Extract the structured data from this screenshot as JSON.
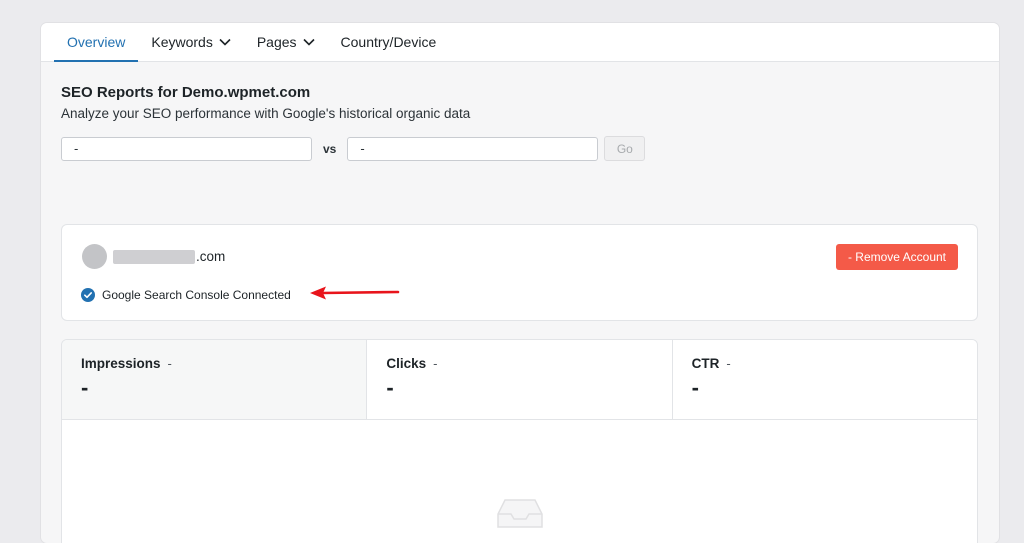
{
  "tabs": [
    {
      "label": "Overview",
      "active": true,
      "dropdown": false
    },
    {
      "label": "Keywords",
      "active": false,
      "dropdown": true
    },
    {
      "label": "Pages",
      "active": false,
      "dropdown": true
    },
    {
      "label": "Country/Device",
      "active": false,
      "dropdown": false
    }
  ],
  "header": {
    "title": "SEO Reports for Demo.wpmet.com",
    "subtitle": "Analyze your SEO performance with Google's historical organic data"
  },
  "compare": {
    "left_value": "-",
    "vs_label": "vs",
    "right_value": "-",
    "go_label": "Go"
  },
  "account": {
    "domain_suffix": ".com",
    "remove_label": "- Remove Account",
    "connected_label": "Google Search Console Connected"
  },
  "metrics": [
    {
      "label": "Impressions",
      "change": "-",
      "value": "-"
    },
    {
      "label": "Clicks",
      "change": "-",
      "value": "-"
    },
    {
      "label": "CTR",
      "change": "-",
      "value": "-"
    }
  ],
  "colors": {
    "accent": "#2271b1",
    "danger": "#f45a48",
    "annotation": "#e8141b"
  }
}
